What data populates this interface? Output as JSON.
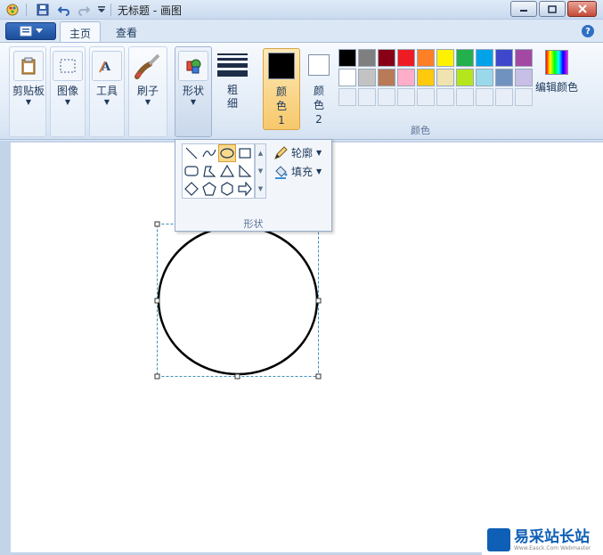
{
  "window": {
    "title": "无标题 - 画图"
  },
  "tabs": [
    {
      "label": "主页",
      "active": true
    },
    {
      "label": "查看",
      "active": false
    }
  ],
  "ribbon": {
    "clipboard": "剪贴板",
    "image": "图像",
    "tools": "工具",
    "brushes": "刷子",
    "shapes": "形状",
    "size": "粗细",
    "color1": "颜色 1",
    "color2": "颜色 2",
    "edit_colors": "编辑颜色",
    "colors_group": "颜色"
  },
  "palette": {
    "row1": [
      "#000000",
      "#7f7f7f",
      "#880015",
      "#ed1c24",
      "#ff7f27",
      "#fff200",
      "#22b14c",
      "#00a2e8",
      "#3f48cc",
      "#a349a4"
    ],
    "row2": [
      "#ffffff",
      "#c3c3c3",
      "#b97a57",
      "#ffaec9",
      "#ffc90e",
      "#efe4b0",
      "#b5e61d",
      "#99d9ea",
      "#7092be",
      "#c8bfe7"
    ]
  },
  "color1_value": "#000000",
  "color2_value": "#ffffff",
  "shapes_dropdown": {
    "outline": "轮廓",
    "fill": "填充",
    "group_label": "形状",
    "selected_shape": "oval"
  },
  "watermark": {
    "main": "易采站长站",
    "sub": "Www.Easck.Com Webmaster"
  }
}
